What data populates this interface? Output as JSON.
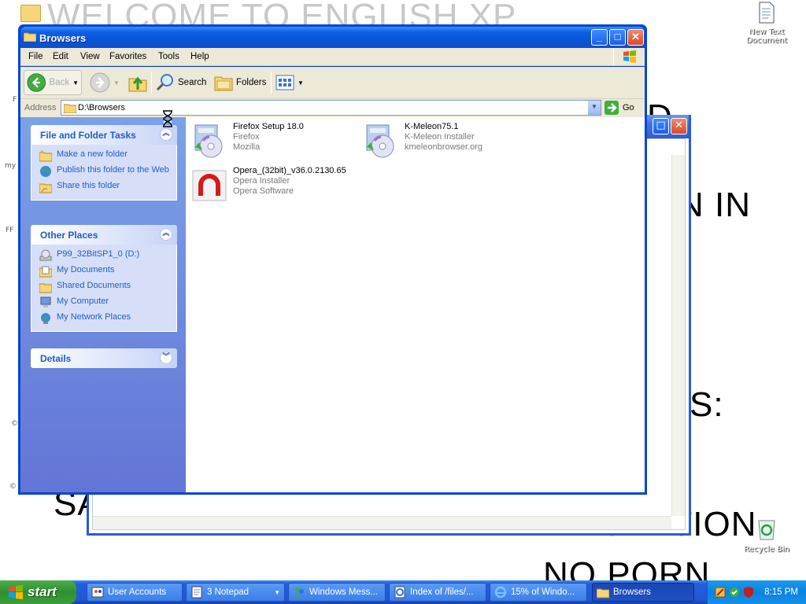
{
  "desktop": {
    "wall_lines": [
      "WELCOME TO ENGLISH XP",
      "D",
      "N IN",
      "S:",
      "SA",
      "INFLATION",
      "NO PORN"
    ],
    "icons": [
      {
        "label": "New Text Document",
        "icon": "text-document-icon"
      },
      {
        "label": "Recycle Bin",
        "icon": "recycle-bin-icon"
      }
    ],
    "side_labels": [
      "F",
      "my",
      "FF",
      "©",
      "©"
    ]
  },
  "window": {
    "title": "Browsers",
    "menu": [
      "File",
      "Edit",
      "View",
      "Favorites",
      "Tools",
      "Help"
    ],
    "toolbar": {
      "back": "Back",
      "search": "Search",
      "folders": "Folders"
    },
    "address": {
      "label": "Address",
      "value": "D:\\Browsers",
      "go": "Go"
    },
    "file_tasks": {
      "title": "File and Folder Tasks",
      "items": [
        "Make a new folder",
        "Publish this folder to the Web",
        "Share this folder"
      ]
    },
    "other_places": {
      "title": "Other Places",
      "items": [
        "P99_32BitSP1_0 (D:)",
        "My Documents",
        "Shared Documents",
        "My Computer",
        "My Network Places"
      ]
    },
    "details": {
      "title": "Details"
    },
    "files": [
      {
        "name": "Firefox Setup 18.0",
        "line2": "Firefox",
        "line3": "Mozilla",
        "icon": "installer-cd-icon"
      },
      {
        "name": "K-Meleon75.1",
        "line2": "K-Meleon Installer",
        "line3": "kmeleonbrowser.org",
        "icon": "installer-cd-icon"
      },
      {
        "name": "Opera_(32bit)_v36.0.2130.65",
        "line2": "Opera Installer",
        "line3": "Opera Software",
        "icon": "opera-installer-icon"
      }
    ]
  },
  "taskbar": {
    "start": "start",
    "tasks": [
      {
        "label": "User Accounts",
        "icon": "user-accounts-icon"
      },
      {
        "label": "3 Notepad",
        "icon": "notepad-icon"
      },
      {
        "label": "Windows Mess...",
        "icon": "messenger-icon"
      },
      {
        "label": "Index of /files/...",
        "icon": "webpage-icon"
      },
      {
        "label": "15% of Windo...",
        "icon": "ie-download-icon"
      },
      {
        "label": "Browsers",
        "icon": "folder-icon"
      }
    ],
    "clock": "8:15 PM"
  }
}
